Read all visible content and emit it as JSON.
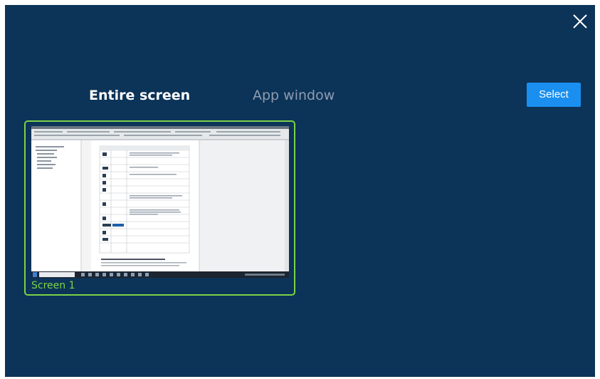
{
  "dialog": {
    "tabs": {
      "entire_screen": "Entire screen",
      "app_window": "App window"
    },
    "select_label": "Select",
    "screen_label": "Screen 1",
    "colors": {
      "background": "#0c3358",
      "accent": "#1a8ff0",
      "selection": "#7bd345",
      "inactive_tab": "#8e9db1"
    },
    "icons": {
      "close": "close-icon"
    }
  }
}
